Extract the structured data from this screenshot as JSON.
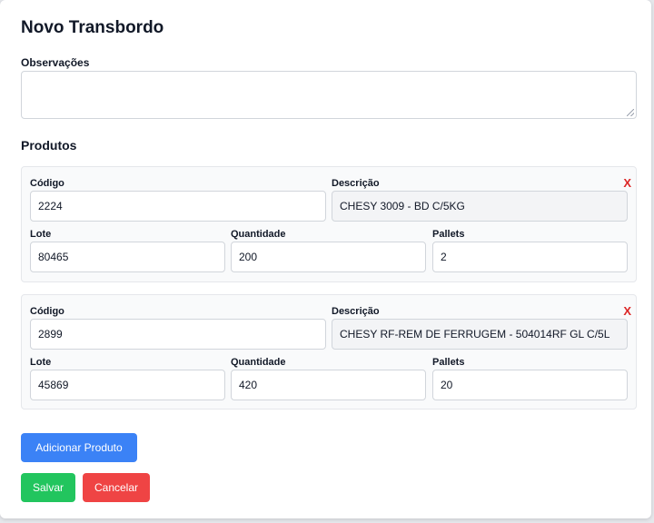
{
  "form": {
    "title": "Novo Transbordo",
    "observations_label": "Observações",
    "observations_value": "",
    "products_heading": "Produtos"
  },
  "labels": {
    "codigo": "Código",
    "descricao": "Descrição",
    "lote": "Lote",
    "quantidade": "Quantidade",
    "pallets": "Pallets",
    "remove": "X"
  },
  "products": [
    {
      "codigo": "2224",
      "descricao": "CHESY 3009 - BD C/5KG",
      "lote": "80465",
      "quantidade": "200",
      "pallets": "2"
    },
    {
      "codigo": "2899",
      "descricao": "CHESY RF-REM DE FERRUGEM - 504014RF GL C/5L",
      "lote": "45869",
      "quantidade": "420",
      "pallets": "20"
    }
  ],
  "buttons": {
    "add_product": "Adicionar Produto",
    "save": "Salvar",
    "cancel": "Cancelar"
  },
  "colors": {
    "primary": "#3b82f6",
    "success": "#22c55e",
    "danger": "#ef4444",
    "remove": "#dc2626"
  }
}
